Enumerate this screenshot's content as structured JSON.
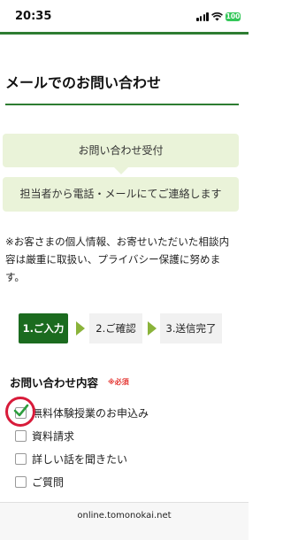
{
  "status_bar": {
    "time": "20:35",
    "battery": "100"
  },
  "page": {
    "title": "メールでのお問い合わせ"
  },
  "banner": {
    "step_text": "お問い合わせ受付",
    "next_text": "担当者から電話・メールにてご連絡します"
  },
  "privacy_note": {
    "line1": "※お客さまの個人情報、お寄せいただいた相談内",
    "line2": "容は厳重に取扱い、プライバシー保護に努めま",
    "line3": "す。"
  },
  "steps": [
    {
      "label": "1.ご入力",
      "active": true
    },
    {
      "label": "2.ご確認",
      "active": false
    },
    {
      "label": "3.送信完了",
      "active": false
    }
  ],
  "inquiry": {
    "title": "お問い合わせ内容",
    "required_label": "※必須",
    "options": [
      {
        "label": "無料体験授業のお申込み",
        "checked": true
      },
      {
        "label": "資料請求",
        "checked": false
      },
      {
        "label": "詳しい話を聞きたい",
        "checked": false
      },
      {
        "label": "ご質問",
        "checked": false
      }
    ]
  },
  "browser": {
    "url": "online.tomonokai.net"
  },
  "colors": {
    "accent_green": "#2e7d32",
    "step_active": "#1b6b1f",
    "banner_bg": "#eaf3d9",
    "required_red": "#e53935",
    "annotation_red": "#d81b3a"
  }
}
